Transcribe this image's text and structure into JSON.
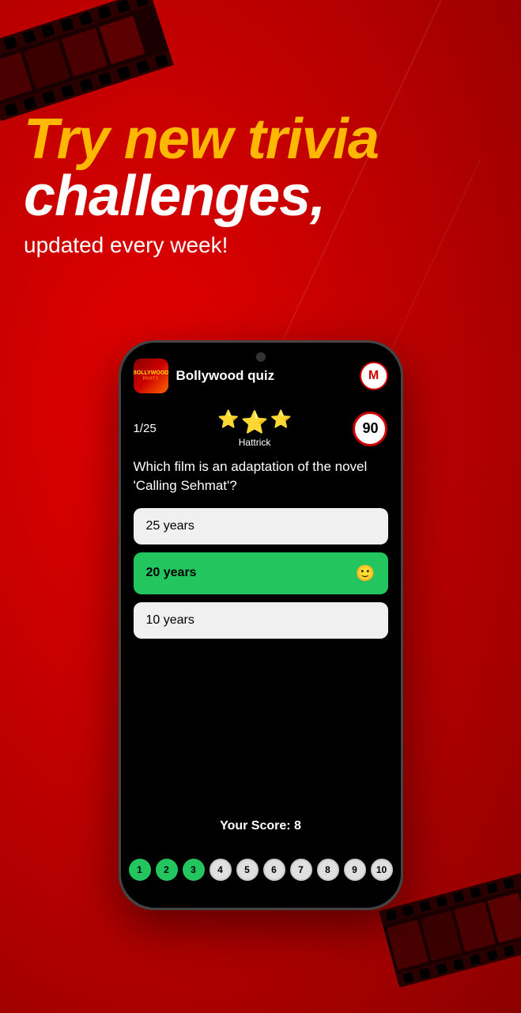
{
  "background": {
    "color": "#cc0000"
  },
  "headline": {
    "line1": "Try new trivia",
    "line2": "challenges,",
    "subtitle": "updated every week!"
  },
  "app": {
    "title": "Bollywood quiz",
    "icon_text": "BOLLYWOOD",
    "avatar_letter": "M"
  },
  "quiz": {
    "question_counter": "1/25",
    "streak_label": "Hattrick",
    "timer_value": "90",
    "question_text": "Which film is an adaptation of the novel 'Calling Sehmat'?",
    "answers": [
      {
        "text": "25 years",
        "style": "white",
        "emoji": ""
      },
      {
        "text": "20 years",
        "style": "green",
        "emoji": "🙂"
      },
      {
        "text": "10 years",
        "style": "white",
        "emoji": ""
      }
    ]
  },
  "score": {
    "label": "Your Score: 8"
  },
  "progress": {
    "dots": [
      {
        "number": "1",
        "state": "filled-green"
      },
      {
        "number": "2",
        "state": "filled-green"
      },
      {
        "number": "3",
        "state": "filled-green"
      },
      {
        "number": "4",
        "state": "filled-white"
      },
      {
        "number": "5",
        "state": "filled-white"
      },
      {
        "number": "6",
        "state": "filled-white"
      },
      {
        "number": "7",
        "state": "filled-white"
      },
      {
        "number": "8",
        "state": "filled-white"
      },
      {
        "number": "9",
        "state": "filled-white"
      },
      {
        "number": "10",
        "state": "filled-white"
      }
    ]
  }
}
